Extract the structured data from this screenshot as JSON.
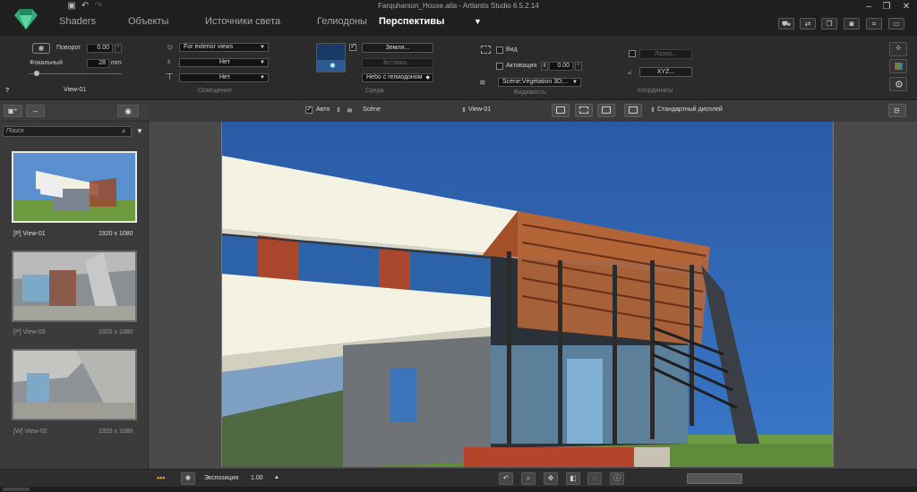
{
  "window": {
    "title": "Farquharson_House.atla - Artlantis Studio 6.5.2.14",
    "minimize_icon": "–",
    "maximize_icon": "❐",
    "close_icon": "✕"
  },
  "tabs": [
    {
      "label": "Shaders"
    },
    {
      "label": "Объекты"
    },
    {
      "label": "Источники света"
    },
    {
      "label": "Гелиодоны"
    },
    {
      "label": "Перспективы"
    }
  ],
  "tabs_more_icon": "▼",
  "params": {
    "rotation_label": "Поворот",
    "rotation_value": "0.00",
    "rotation_unit": "°",
    "focal_label": "Фокальный",
    "focal_value": "28",
    "focal_unit": "mm",
    "view_name": "View-01",
    "lighting": {
      "sun_option": "For exterior views",
      "light2": "Нет",
      "light3": "Нет",
      "group_label": "Освещение"
    },
    "environment": {
      "ground_button": "Земля...",
      "insert_button": "Вставка...",
      "sky_option": "Небо с гелиодоном",
      "group_label": "Среда"
    },
    "visibility": {
      "view_label": "Вид",
      "activation_label": "Активация",
      "activation_value": "0.00",
      "activation_unit": "°",
      "scene_option": "Scène;Végétation 3D;...",
      "group_label": "Видимость"
    },
    "coordinates": {
      "laser_button": "Лазер...",
      "xyz_button": "XYZ...",
      "group_label": "Координаты"
    },
    "help": "?"
  },
  "view_toolbar": {
    "auto_label": "Авто",
    "scene_label": "Scène",
    "view_select": "View-01",
    "display_select": "Стандартный дисплей"
  },
  "left_panel": {
    "search_placeholder": "Поиск",
    "minus_button": "–",
    "thumbnails": [
      {
        "name": "[P] View-01",
        "resolution": "1920 x 1080",
        "selected": true
      },
      {
        "name": "[P] View-03",
        "resolution": "1920 x 1080",
        "selected": false
      },
      {
        "name": "[W] View-02",
        "resolution": "1920 x 1080",
        "selected": false
      }
    ]
  },
  "bottom": {
    "dots": "•••",
    "exposure_label": "Экспозиция",
    "exposure_value": "1.00",
    "exposure_up": "▲"
  },
  "colors": {
    "accent_green": "#2fae7a",
    "sky_blue": "#2f64b0",
    "pergola_brown": "#9a4a2c",
    "wall_cream": "#f4f2e2"
  }
}
